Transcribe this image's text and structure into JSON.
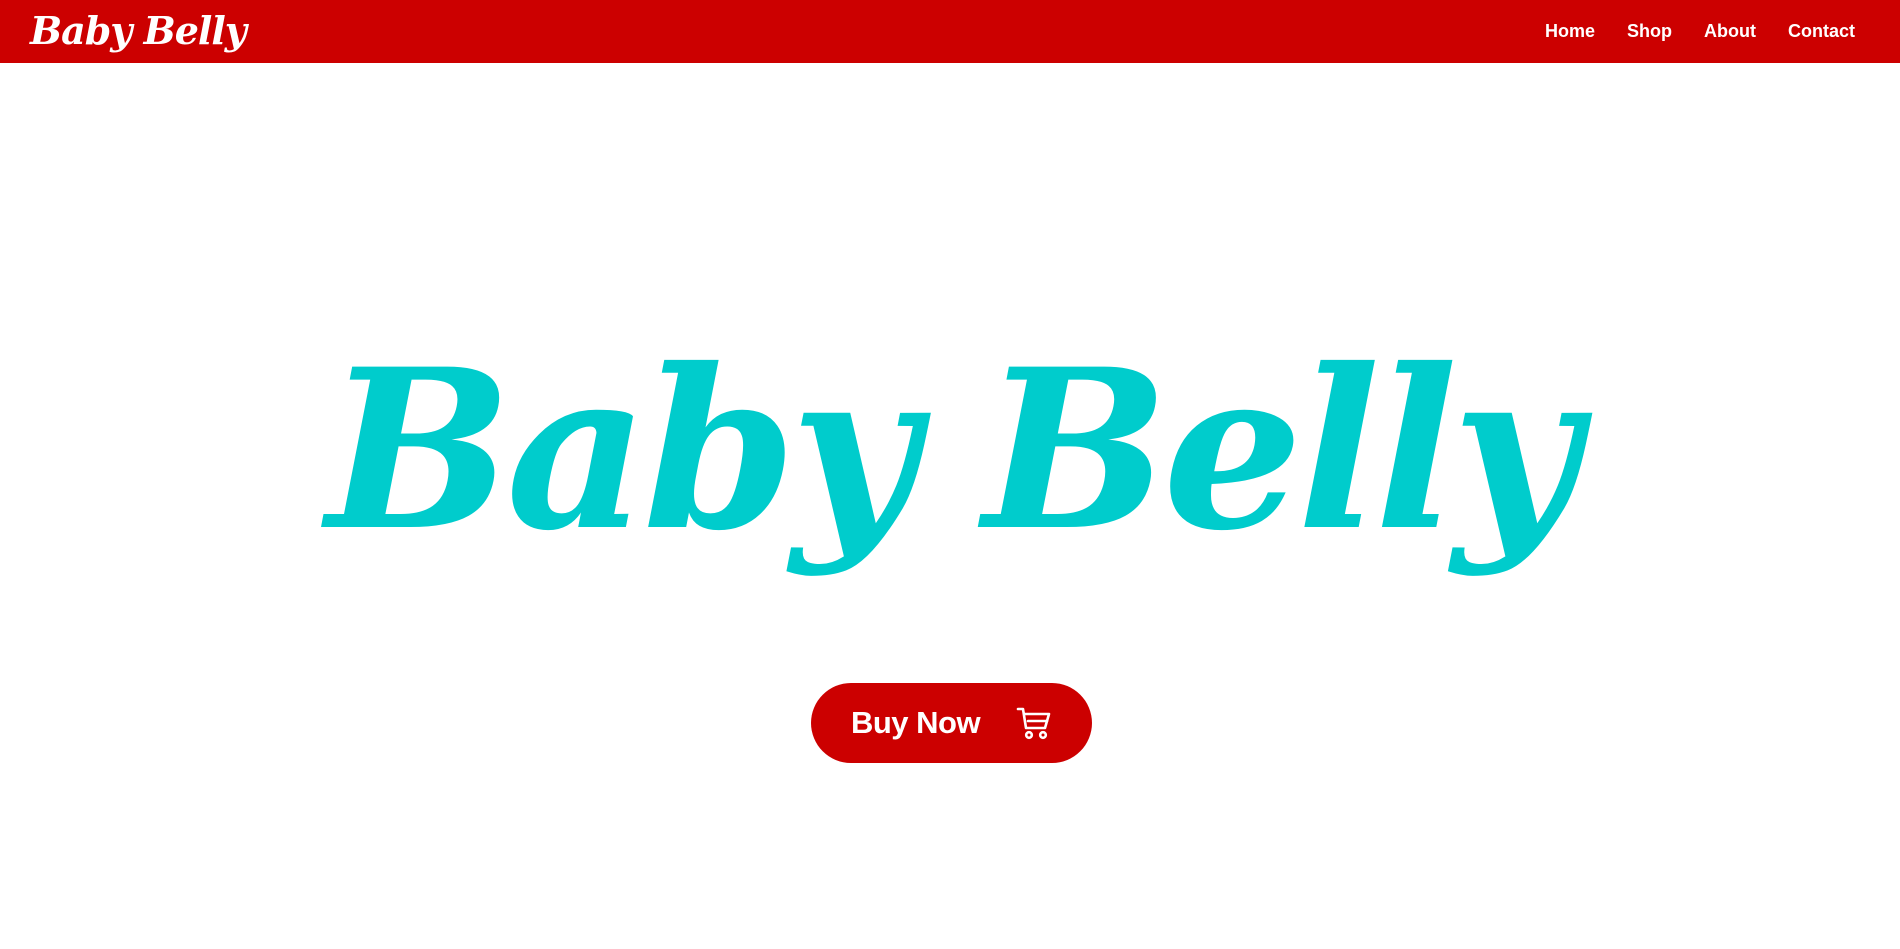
{
  "header": {
    "logo_text": "Baby Belly",
    "nav": [
      {
        "label": "Home"
      },
      {
        "label": "Shop"
      },
      {
        "label": "About"
      },
      {
        "label": "Contact"
      }
    ]
  },
  "hero": {
    "title": "Baby Belly",
    "cta_label": "Buy Now",
    "cta_icon": "shopping-cart-icon"
  },
  "colors": {
    "brand_red": "#cc0000",
    "title_teal": "#00cccc",
    "background": "#ffffff"
  }
}
